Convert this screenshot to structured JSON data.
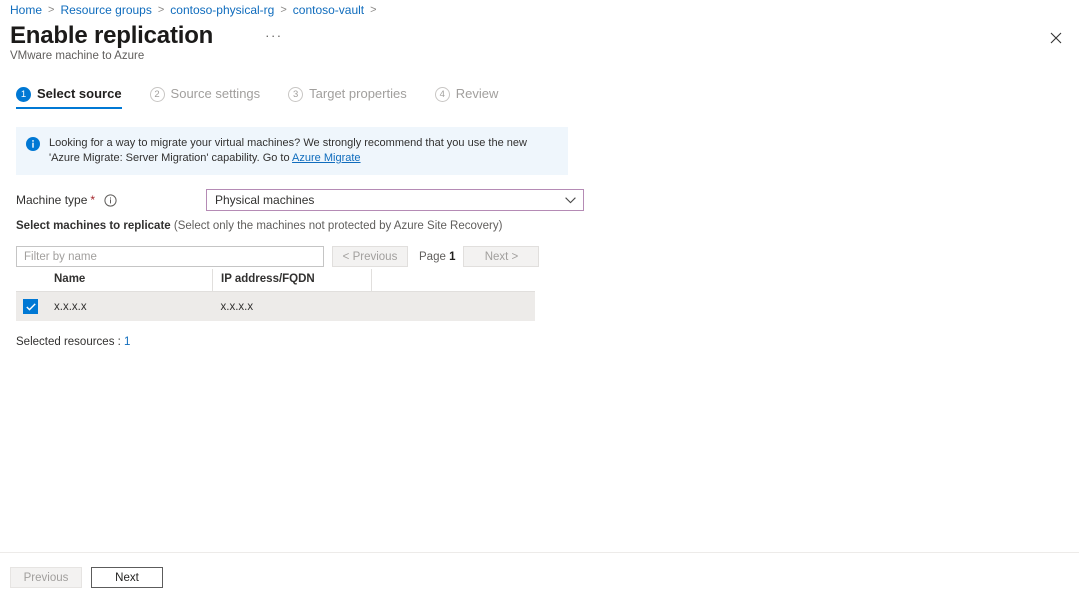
{
  "breadcrumb": {
    "items": [
      {
        "label": "Home"
      },
      {
        "label": "Resource groups"
      },
      {
        "label": "contoso-physical-rg"
      },
      {
        "label": "contoso-vault"
      }
    ],
    "separator": ">"
  },
  "header": {
    "title": "Enable replication",
    "subtitle": "VMware machine to Azure",
    "ellipsis_label": "···",
    "close_label": "Close"
  },
  "tabs": [
    {
      "number": "1",
      "label": "Select source",
      "active": true
    },
    {
      "number": "2",
      "label": "Source settings",
      "active": false
    },
    {
      "number": "3",
      "label": "Target properties",
      "active": false
    },
    {
      "number": "4",
      "label": "Review",
      "active": false
    }
  ],
  "banner": {
    "text_before": "Looking for a way to migrate your virtual machines? We strongly recommend that you use the new 'Azure Migrate: Server Migration' capability. Go to ",
    "link_label": "Azure Migrate",
    "background": "#eff6fc",
    "icon_color": "#0078d4"
  },
  "machine_type": {
    "label": "Machine type",
    "required_marker": "*",
    "selected_value": "Physical machines",
    "border_color": "#b58bb5"
  },
  "section": {
    "heading_strong": "Select machines to replicate",
    "heading_muted": " (Select only the machines not protected by Azure Site Recovery)"
  },
  "filter": {
    "placeholder": "Filter by name",
    "value": ""
  },
  "pagination": {
    "previous_label": "< Previous",
    "next_label": "Next >",
    "page_word": "Page",
    "page_number": "1"
  },
  "table": {
    "columns": [
      "",
      "Name",
      "IP address/FQDN",
      ""
    ],
    "rows": [
      {
        "selected": true,
        "name": "x.x.x.x",
        "ip": "x.x.x.x",
        "extra": ""
      }
    ]
  },
  "selected_resources": {
    "label": "Selected resources : ",
    "count": "1"
  },
  "footer": {
    "previous_label": "Previous",
    "next_label": "Next"
  },
  "colors": {
    "accent": "#0078d4",
    "link": "#0f6cbd",
    "required": "#a4262c",
    "row_selected_bg": "#edebe9"
  }
}
